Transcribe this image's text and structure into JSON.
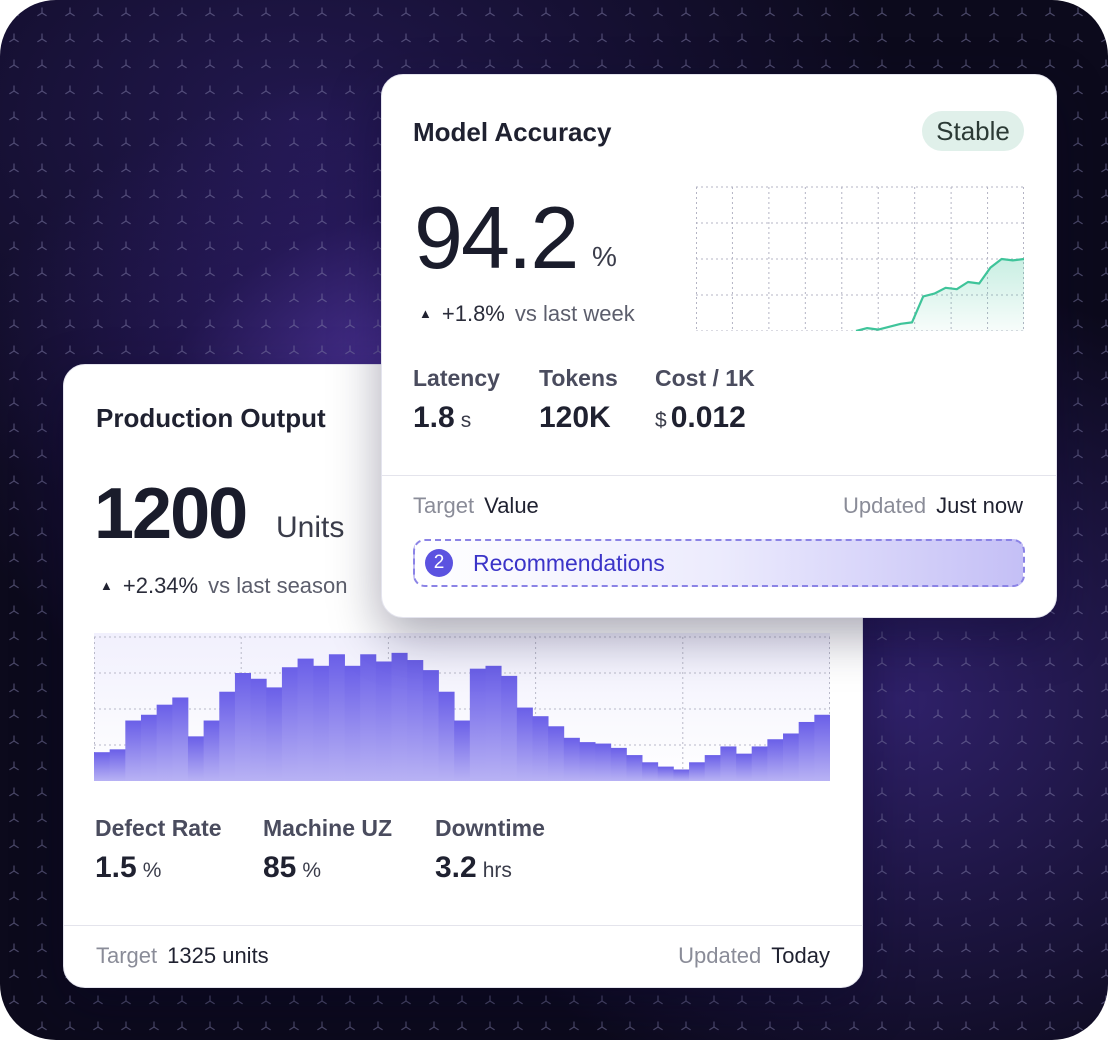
{
  "production_card": {
    "title": "Production Output",
    "value": "1200",
    "unit": "Units",
    "change": "+2.34%",
    "change_context": "vs last season",
    "metrics": [
      {
        "label": "Defect Rate",
        "value": "1.5",
        "unit": "%"
      },
      {
        "label": "Machine UZ",
        "value": "85",
        "unit": "%"
      },
      {
        "label": "Downtime",
        "value": "3.2",
        "unit": "hrs"
      }
    ],
    "target_label": "Target",
    "target_value": "1325 units",
    "updated_label": "Updated",
    "updated_value": "Today"
  },
  "model_card": {
    "title": "Model Accuracy",
    "badge": "Stable",
    "value": "94.2",
    "unit": "%",
    "change": "+1.8%",
    "change_context": "vs last week",
    "metrics": [
      {
        "label": "Latency",
        "value": "1.8",
        "unit": "s",
        "prefix": ""
      },
      {
        "label": "Tokens",
        "value": "120K",
        "unit": "",
        "prefix": ""
      },
      {
        "label": "Cost / 1K",
        "value": "0.012",
        "unit": "",
        "prefix": "$"
      }
    ],
    "target_label": "Target",
    "target_value": "Value",
    "updated_label": "Updated",
    "updated_value": "Just now",
    "recommendations_count": "2",
    "recommendations_label": "Recommendations"
  },
  "chart_data": [
    {
      "type": "bar",
      "values": [
        0.2,
        0.22,
        0.42,
        0.46,
        0.53,
        0.58,
        0.31,
        0.42,
        0.62,
        0.75,
        0.71,
        0.65,
        0.79,
        0.85,
        0.8,
        0.88,
        0.8,
        0.88,
        0.83,
        0.89,
        0.84,
        0.77,
        0.62,
        0.42,
        0.78,
        0.8,
        0.73,
        0.51,
        0.45,
        0.38,
        0.3,
        0.27,
        0.26,
        0.23,
        0.18,
        0.13,
        0.1,
        0.08,
        0.13,
        0.18,
        0.24,
        0.19,
        0.24,
        0.29,
        0.33,
        0.41,
        0.46
      ],
      "ylim": [
        0,
        1
      ],
      "grid": true,
      "color": "#6a5fe8"
    },
    {
      "type": "area",
      "values": [
        0,
        0.02,
        0.01,
        0.03,
        0.05,
        0.06,
        0.24,
        0.26,
        0.3,
        0.29,
        0.34,
        0.33,
        0.44,
        0.5,
        0.49,
        0.5
      ],
      "ylim": [
        0,
        1
      ],
      "grid": true,
      "color": "#3fc49a"
    }
  ]
}
